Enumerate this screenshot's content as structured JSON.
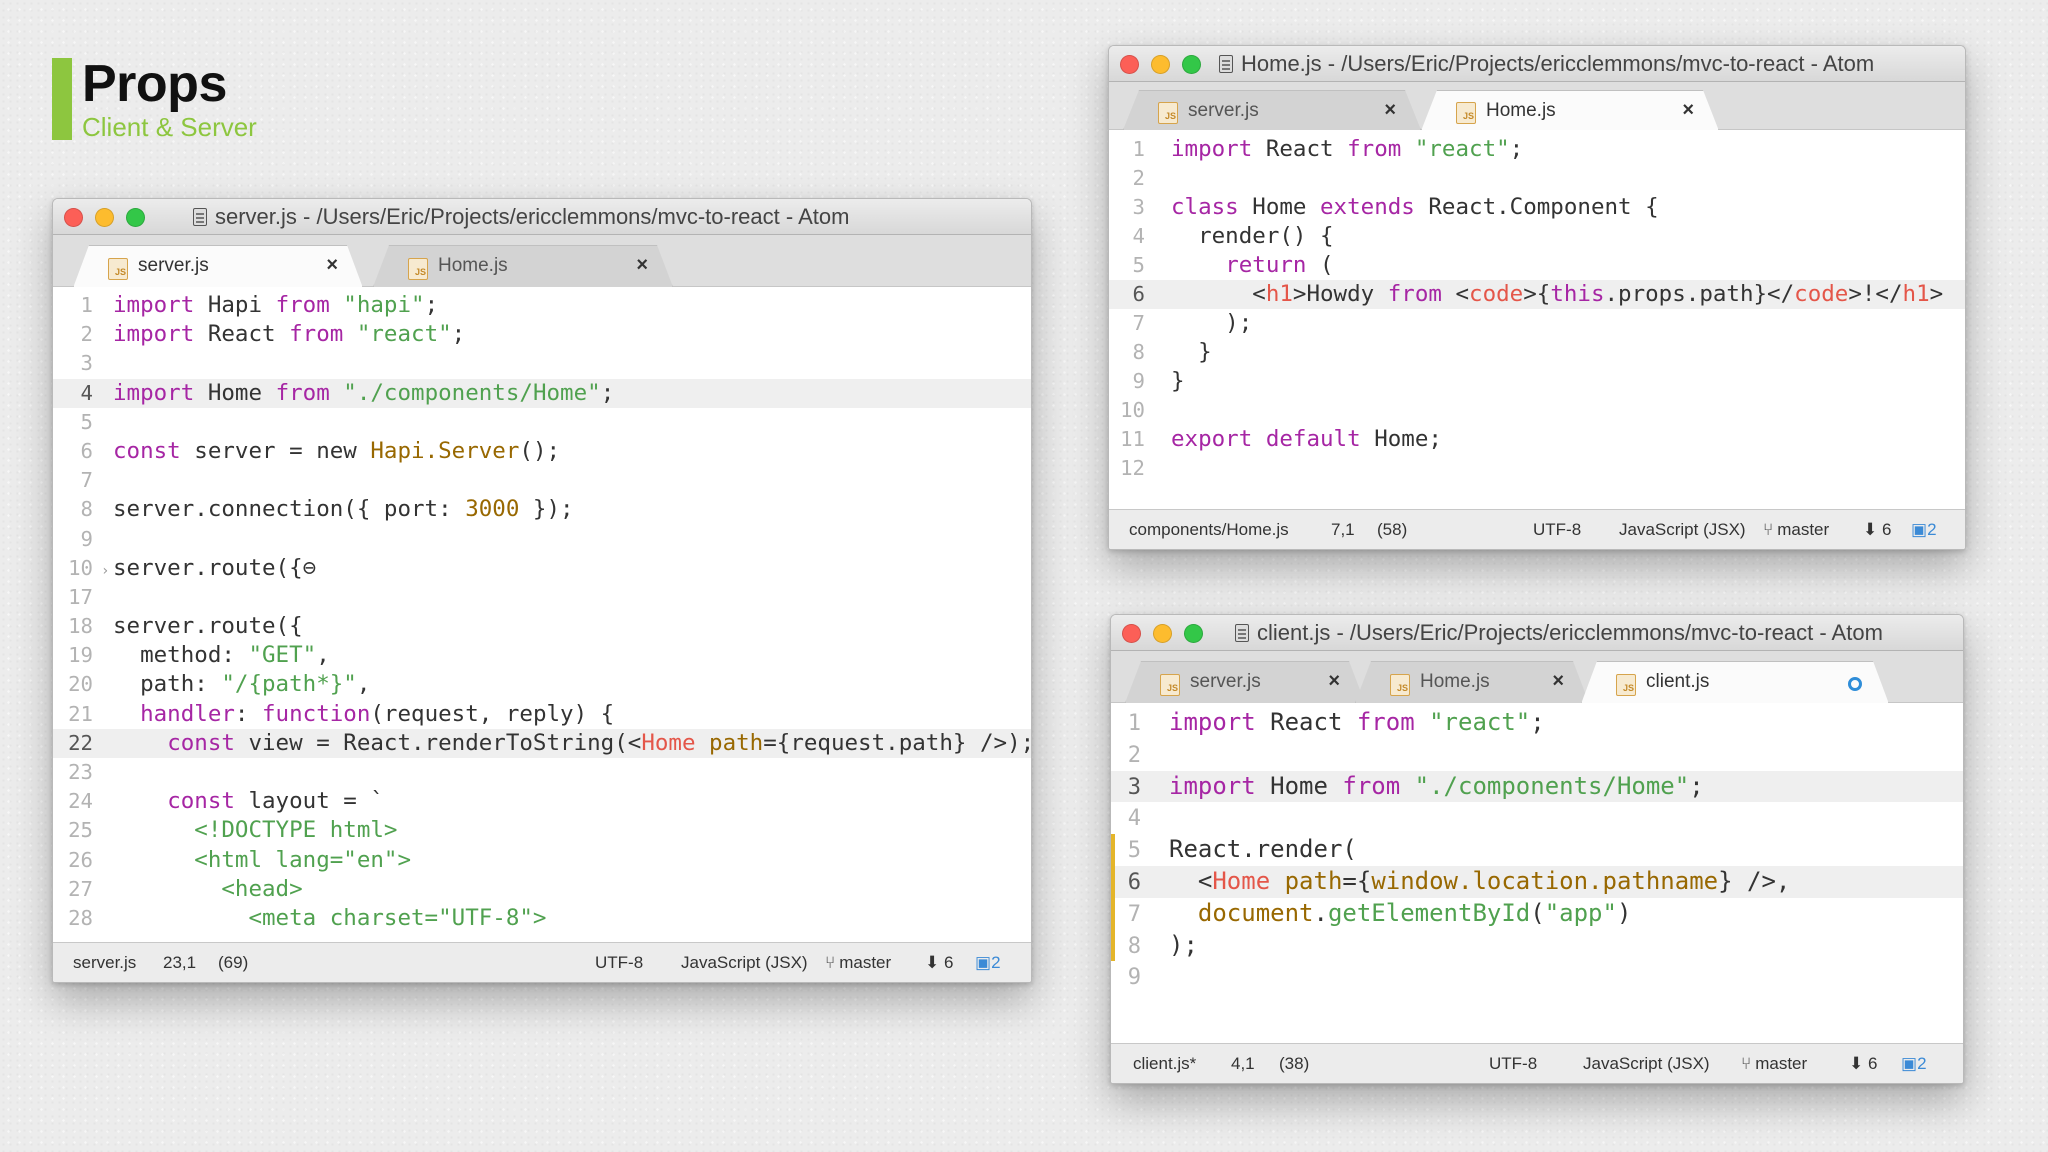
{
  "slide": {
    "title": "Props",
    "subtitle": "Client & Server"
  },
  "windows": {
    "server": {
      "title": "server.js - /Users/Eric/Projects/ericclemmons/mvc-to-react - Atom",
      "tabs": [
        {
          "label": "server.js",
          "active": true
        },
        {
          "label": "Home.js",
          "active": false
        }
      ],
      "status": {
        "file": "server.js",
        "cursor": "23,1",
        "selection": "(69)",
        "encoding": "UTF-8",
        "grammar": "JavaScript (JSX)",
        "branch": "master",
        "behind": "6",
        "changes": "2"
      }
    },
    "home": {
      "title": "Home.js - /Users/Eric/Projects/ericclemmons/mvc-to-react - Atom",
      "tabs": [
        {
          "label": "server.js",
          "active": false
        },
        {
          "label": "Home.js",
          "active": true
        }
      ],
      "status": {
        "file": "components/Home.js",
        "cursor": "7,1",
        "selection": "(58)",
        "encoding": "UTF-8",
        "grammar": "JavaScript (JSX)",
        "branch": "master",
        "behind": "6",
        "changes": "2"
      }
    },
    "client": {
      "title": "client.js - /Users/Eric/Projects/ericclemmons/mvc-to-react - Atom",
      "tabs": [
        {
          "label": "server.js",
          "active": false
        },
        {
          "label": "Home.js",
          "active": false
        },
        {
          "label": "client.js",
          "active": true
        }
      ],
      "status": {
        "file": "client.js*",
        "cursor": "4,1",
        "selection": "(38)",
        "encoding": "UTF-8",
        "grammar": "JavaScript (JSX)",
        "branch": "master",
        "behind": "6",
        "changes": "2"
      }
    }
  },
  "code": {
    "server": [
      {
        "n": "1",
        "tokens": [
          [
            "k",
            "import"
          ],
          [
            "",
            " Hapi "
          ],
          [
            "k",
            "from"
          ],
          [
            "",
            " "
          ],
          [
            "s",
            "\"hapi\""
          ],
          [
            "",
            ";"
          ]
        ]
      },
      {
        "n": "2",
        "tokens": [
          [
            "k",
            "import"
          ],
          [
            "",
            " React "
          ],
          [
            "k",
            "from"
          ],
          [
            "",
            " "
          ],
          [
            "s",
            "\"react\""
          ],
          [
            "",
            ";"
          ]
        ]
      },
      {
        "n": "3",
        "tokens": []
      },
      {
        "n": "4",
        "cur": true,
        "tokens": [
          [
            "k",
            "import"
          ],
          [
            "",
            " Home "
          ],
          [
            "k",
            "from"
          ],
          [
            "",
            " "
          ],
          [
            "s",
            "\"./components/Home\""
          ],
          [
            "",
            ";"
          ]
        ]
      },
      {
        "n": "5",
        "tokens": []
      },
      {
        "n": "6",
        "tokens": [
          [
            "k",
            "const"
          ],
          [
            "",
            " server = new "
          ],
          [
            "a",
            "Hapi.Server"
          ],
          [
            "",
            "();"
          ]
        ]
      },
      {
        "n": "7",
        "tokens": []
      },
      {
        "n": "8",
        "tokens": [
          [
            "",
            "server.connection({ port: "
          ],
          [
            "n",
            "3000"
          ],
          [
            "",
            " });"
          ]
        ]
      },
      {
        "n": "9",
        "tokens": []
      },
      {
        "n": "10",
        "fold": true,
        "tokens": [
          [
            "",
            "server.route({"
          ],
          [
            "",
            "⊖"
          ]
        ]
      },
      {
        "n": "17",
        "tokens": []
      },
      {
        "n": "18",
        "tokens": [
          [
            "",
            "server.route({"
          ]
        ]
      },
      {
        "n": "19",
        "tokens": [
          [
            "",
            "  method: "
          ],
          [
            "s",
            "\"GET\""
          ],
          [
            "",
            ","
          ]
        ]
      },
      {
        "n": "20",
        "tokens": [
          [
            "",
            "  path: "
          ],
          [
            "s",
            "\"/{path*}\""
          ],
          [
            "",
            ","
          ]
        ]
      },
      {
        "n": "21",
        "tokens": [
          [
            "",
            "  "
          ],
          [
            "k",
            "handler"
          ],
          [
            "",
            ": "
          ],
          [
            "k",
            "function"
          ],
          [
            "",
            "(request, reply) {"
          ]
        ]
      },
      {
        "n": "22",
        "cur": true,
        "tokens": [
          [
            "",
            "    "
          ],
          [
            "k",
            "const"
          ],
          [
            "",
            " view = React.renderToString(<"
          ],
          [
            "t",
            "Home"
          ],
          [
            "",
            " "
          ],
          [
            "a",
            "path"
          ],
          [
            "",
            "={request.path} />);"
          ]
        ]
      },
      {
        "n": "23",
        "tokens": []
      },
      {
        "n": "24",
        "tokens": [
          [
            "",
            "    "
          ],
          [
            "k",
            "const"
          ],
          [
            "",
            " layout = `"
          ]
        ]
      },
      {
        "n": "25",
        "tokens": [
          [
            "s",
            "      <!DOCTYPE html>"
          ]
        ]
      },
      {
        "n": "26",
        "tokens": [
          [
            "s",
            "      <html lang=\"en\">"
          ]
        ]
      },
      {
        "n": "27",
        "tokens": [
          [
            "s",
            "        <head>"
          ]
        ]
      },
      {
        "n": "28",
        "tokens": [
          [
            "s",
            "          <meta charset=\"UTF-8\">"
          ]
        ]
      }
    ],
    "home": [
      {
        "n": "1",
        "tokens": [
          [
            "k",
            "import"
          ],
          [
            "",
            " React "
          ],
          [
            "k",
            "from"
          ],
          [
            "",
            " "
          ],
          [
            "s",
            "\"react\""
          ],
          [
            "",
            ";"
          ]
        ]
      },
      {
        "n": "2",
        "tokens": []
      },
      {
        "n": "3",
        "tokens": [
          [
            "k",
            "class"
          ],
          [
            "",
            " Home "
          ],
          [
            "k",
            "extends"
          ],
          [
            "",
            " React.Component {"
          ]
        ]
      },
      {
        "n": "4",
        "tokens": [
          [
            "",
            "  render() {"
          ]
        ]
      },
      {
        "n": "5",
        "tokens": [
          [
            "",
            "    "
          ],
          [
            "k",
            "return"
          ],
          [
            "",
            " ("
          ]
        ]
      },
      {
        "n": "6",
        "cur": true,
        "tokens": [
          [
            "",
            "      <"
          ],
          [
            "t",
            "h1"
          ],
          [
            "",
            ">Howdy "
          ],
          [
            "k",
            "from"
          ],
          [
            "",
            " <"
          ],
          [
            "t",
            "code"
          ],
          [
            "",
            ">{"
          ],
          [
            "k",
            "this"
          ],
          [
            "",
            ".props.path}</"
          ],
          [
            "t",
            "code"
          ],
          [
            "",
            ">!</"
          ],
          [
            "t",
            "h1"
          ],
          [
            "",
            ">"
          ]
        ]
      },
      {
        "n": "7",
        "tokens": [
          [
            "",
            "    );"
          ]
        ]
      },
      {
        "n": "8",
        "tokens": [
          [
            "",
            "  }"
          ]
        ]
      },
      {
        "n": "9",
        "tokens": [
          [
            "",
            "}"
          ]
        ]
      },
      {
        "n": "10",
        "tokens": []
      },
      {
        "n": "11",
        "tokens": [
          [
            "k",
            "export"
          ],
          [
            "",
            " "
          ],
          [
            "k",
            "default"
          ],
          [
            "",
            " Home;"
          ]
        ]
      },
      {
        "n": "12",
        "tokens": []
      }
    ],
    "client": [
      {
        "n": "1",
        "tokens": [
          [
            "k",
            "import"
          ],
          [
            "",
            " React "
          ],
          [
            "k",
            "from"
          ],
          [
            "",
            " "
          ],
          [
            "s",
            "\"react\""
          ],
          [
            "",
            ";"
          ]
        ]
      },
      {
        "n": "2",
        "tokens": []
      },
      {
        "n": "3",
        "cur": true,
        "tokens": [
          [
            "k",
            "import"
          ],
          [
            "",
            " Home "
          ],
          [
            "k",
            "from"
          ],
          [
            "",
            " "
          ],
          [
            "s",
            "\"./components/Home\""
          ],
          [
            "",
            ";"
          ]
        ]
      },
      {
        "n": "4",
        "tokens": []
      },
      {
        "n": "5",
        "mod": true,
        "tokens": [
          [
            "",
            "React.render("
          ]
        ]
      },
      {
        "n": "6",
        "mod": true,
        "cur": true,
        "tokens": [
          [
            "",
            "  <"
          ],
          [
            "t",
            "Home"
          ],
          [
            "",
            " "
          ],
          [
            "a",
            "path"
          ],
          [
            "",
            "={"
          ],
          [
            "a",
            "window.location.pathname"
          ],
          [
            "",
            "} />,"
          ]
        ]
      },
      {
        "n": "7",
        "mod": true,
        "tokens": [
          [
            "",
            "  "
          ],
          [
            "a",
            "document"
          ],
          [
            "",
            "."
          ],
          [
            "s",
            "getElementById"
          ],
          [
            "",
            "("
          ],
          [
            "s",
            "\"app\""
          ],
          [
            "",
            ")"
          ]
        ]
      },
      {
        "n": "8",
        "mod": true,
        "tokens": [
          [
            "",
            ");"
          ]
        ]
      },
      {
        "n": "9",
        "tokens": []
      }
    ]
  }
}
